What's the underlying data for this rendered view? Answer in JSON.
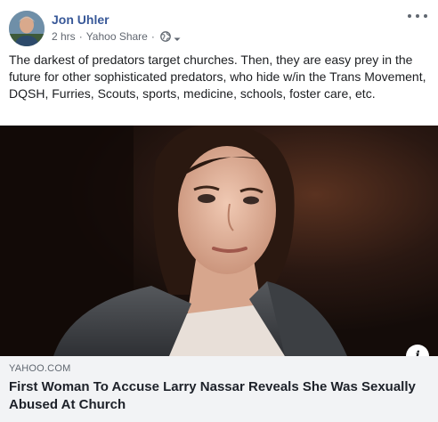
{
  "post": {
    "author": "Jon Uhler",
    "time": "2 hrs",
    "source": "Yahoo Share",
    "separator": "·",
    "privacy_icon": "globe-icon",
    "more_icon": "more-options-icon",
    "text": "The darkest of predators target churches. Then, they are easy prey in the future for other sophisticated predators, who hide w/in the Trans Movement, DQSH, Furries, Scouts, sports, medicine, schools, foster care, etc."
  },
  "link": {
    "domain": "YAHOO.COM",
    "headline": "First Woman To Accuse Larry Nassar Reveals She Was Sexually Abused At Church",
    "info_label": "i"
  },
  "colors": {
    "author_name": "#385898",
    "meta_text": "#616770",
    "preview_bg": "#f2f3f5"
  }
}
